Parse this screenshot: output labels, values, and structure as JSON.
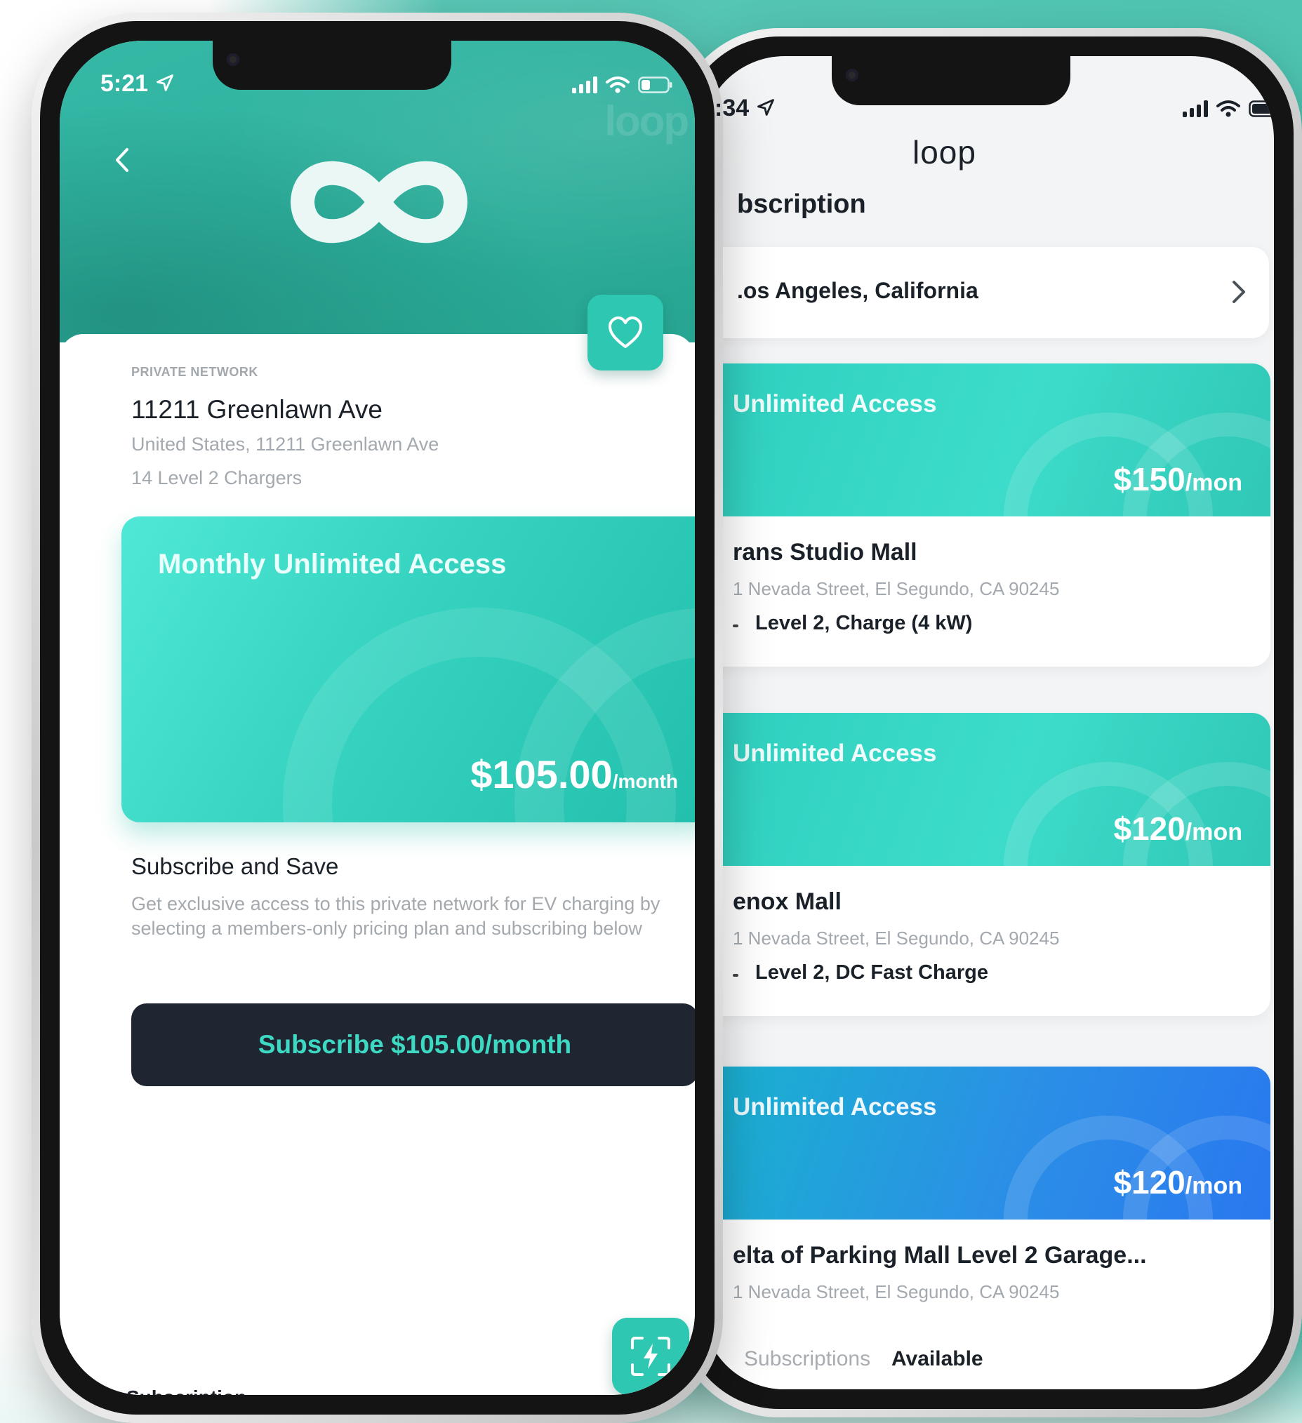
{
  "colors": {
    "accent": "#2ec7b2",
    "dark_button": "#1f2631",
    "button_text": "#3dd9c3",
    "text_primary": "#1b2129",
    "text_muted": "#a3a9ae",
    "blue_card": "#2a78ef"
  },
  "left_phone": {
    "status_time": "5:21",
    "hero_watermark": "loop",
    "back_icon": "chevron-left-icon",
    "logo_icon": "infinity-logo-icon",
    "favorite_icon": "heart-icon",
    "network_type": "PRIVATE NETWORK",
    "location_name": "11211 Greenlawn Ave",
    "location_address": "United States, 11211 Greenlawn Ave",
    "charger_count": "14 Level 2 Chargers",
    "plan": {
      "title": "Monthly Unlimited Access",
      "price": "$105.00",
      "period": "/month"
    },
    "subscribe_heading": "Subscribe and Save",
    "subscribe_description": "Get exclusive access to this private network for EV charging by selecting a members-only pricing plan and subscribing below",
    "subscribe_button_label": "Subscribe $105.00/month",
    "scan_icon": "scan-charge-icon",
    "bottom_tab_label": "Subscription"
  },
  "right_phone": {
    "status_time": ":34",
    "app_logo": "loop",
    "page_title": "bscription",
    "location_selector": ".os Angeles, California",
    "plans": [
      {
        "access_label": "Unlimited Access",
        "price": "$150",
        "period": "/mon",
        "name": "rans Studio Mall",
        "address": "1 Nevada Street, El Segundo, CA 90245",
        "spec": "Level 2, Charge (4 kW)"
      },
      {
        "access_label": "Unlimited Access",
        "price": "$120",
        "period": "/mon",
        "name": "enox Mall",
        "address": "1 Nevada Street, El Segundo, CA 90245",
        "spec": "Level 2, DC Fast Charge"
      },
      {
        "access_label": "Unlimited Access",
        "price": "$120",
        "period": "/mon",
        "name": "elta of Parking Mall Level 2 Garage...",
        "address": "1 Nevada Street, El Segundo, CA 90245",
        "spec": ""
      }
    ],
    "tabs": [
      {
        "label": "Subscriptions"
      },
      {
        "label": "Available"
      }
    ]
  }
}
